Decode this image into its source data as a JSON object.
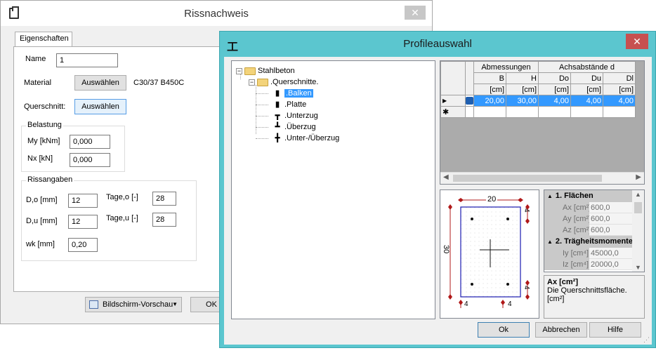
{
  "window1": {
    "title": "Rissnachweis",
    "close_icon": "close-icon",
    "tab": "Eigenschaften",
    "name_label": "Name",
    "name_value": "1",
    "material_label": "Material",
    "material_button": "Auswählen",
    "material_value": "C30/37 B450C",
    "querschnitt_label": "Querschnitt:",
    "querschnitt_button": "Auswählen",
    "belastung": {
      "title": "Belastung",
      "my_label": "My [kNm]",
      "my_value": "0,000",
      "nx_label": "Nx [kN]",
      "nx_value": "0,000"
    },
    "rissangaben": {
      "title": "Rissangaben",
      "do_label": "D,o [mm]",
      "do_value": "12",
      "tageo_label": "Tage,o [-]",
      "tageo_value": "28",
      "du_label": "D,u [mm]",
      "du_value": "12",
      "tageu_label": "Tage,u [-]",
      "tageu_value": "28",
      "wk_label": "wk [mm]",
      "wk_value": "0,20"
    },
    "preview_button": "Bildschirm-Vorschau",
    "ok_button": "OK"
  },
  "window2": {
    "title": "Profileauswahl",
    "tree": {
      "root": "Stahlbeton",
      "group": ".Querschnitte.",
      "items": [
        ".Balken",
        ".Platte",
        ".Unterzug",
        ".Überzug",
        ".Unter-/Überzug"
      ],
      "selected": ".Balken"
    },
    "grid": {
      "group_headers": [
        "Abmessungen",
        "Achsabstände d"
      ],
      "columns": [
        "B",
        "H",
        "Do",
        "Du",
        "Dl"
      ],
      "units": [
        "[cm]",
        "[cm]",
        "[cm]",
        "[cm]",
        "[cm]"
      ],
      "row_values": [
        "20,00",
        "30,00",
        "4,00",
        "4,00",
        "4,00"
      ],
      "row_marker": "▶",
      "new_row_marker": "✱"
    },
    "drawing": {
      "width_label": "20",
      "height_label": "30",
      "top_right": "4",
      "bottom_right": "4",
      "bottom_left": "4",
      "bottom_mid": "4"
    },
    "properties": {
      "cat1": "1. Flächen",
      "rows1": [
        {
          "key": "Ax [cm²]",
          "value": "600,0"
        },
        {
          "key": "Ay [cm²]",
          "value": "600,0"
        },
        {
          "key": "Az [cm²]",
          "value": "600,0"
        }
      ],
      "cat2": "2. Trägheitsmomente",
      "rows2": [
        {
          "key": "Iy [cm⁴]",
          "value": "45000,0"
        },
        {
          "key": "Iz [cm⁴]",
          "value": "20000,0"
        }
      ]
    },
    "description": {
      "title": "Ax [cm²]",
      "text": "Die Querschnittsfläche. [cm²]"
    },
    "buttons": {
      "ok": "Ok",
      "cancel": "Abbrechen",
      "help": "Hilfe"
    }
  }
}
